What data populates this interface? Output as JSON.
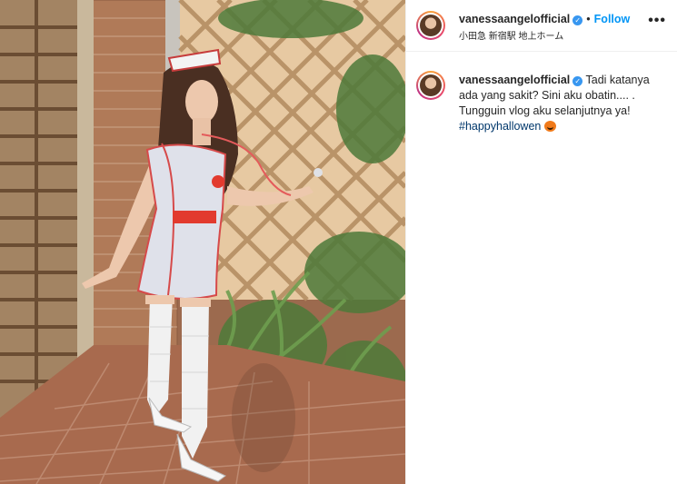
{
  "post": {
    "username": "vanessaangelofficial",
    "verified_icon": "verified-badge-icon",
    "follow_label": "Follow",
    "separator": "•",
    "location": "小田急 新宿駅 地上ホーム",
    "more_icon": "more-options-icon",
    "more_label": "•••",
    "caption": {
      "username": "vanessaangelofficial",
      "text": "Tadi katanya ada yang sakit? Sini aku obatin.... . Tungguin vlog aku selanjutnya ya!",
      "hashtag": "#happyhallowen",
      "emoji_icon": "jack-o-lantern-icon"
    }
  },
  "colors": {
    "follow": "#0095f6",
    "hashtag": "#00376b",
    "verified": "#3897f0",
    "text": "#262626",
    "divider": "#efefef"
  }
}
